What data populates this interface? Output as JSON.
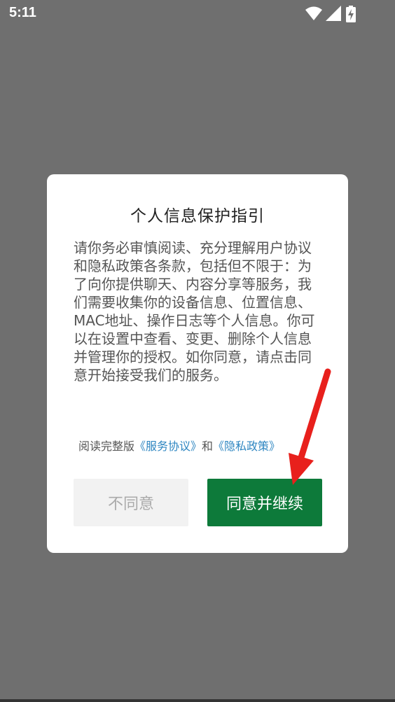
{
  "status_bar": {
    "time": "5:11",
    "icons": [
      "wifi-icon",
      "signal-icon",
      "battery-charging-icon"
    ]
  },
  "dialog": {
    "title": "个人信息保护指引",
    "body": "请你务必审慎阅读、充分理解用户协议和隐私政策各条款，包括但不限于：为了向你提供聊天、内容分享等服务，我们需要收集你的设备信息、位置信息、MAC地址、操作日志等个人信息。你可以在设置中查看、变更、删除个人信息并管理你的授权。如你同意，请点击同意开始接受我们的服务。",
    "links": {
      "prefix": "阅读完整版",
      "service_agreement": "《服务协议》",
      "and": "和",
      "privacy_policy": "《隐私政策》"
    },
    "buttons": {
      "disagree": "不同意",
      "agree": "同意并继续"
    }
  },
  "colors": {
    "overlay": "#6f6f6f",
    "accent_green": "#0d7a3a",
    "link_blue": "#2e86c1",
    "annotation_arrow": "#e8201c"
  }
}
